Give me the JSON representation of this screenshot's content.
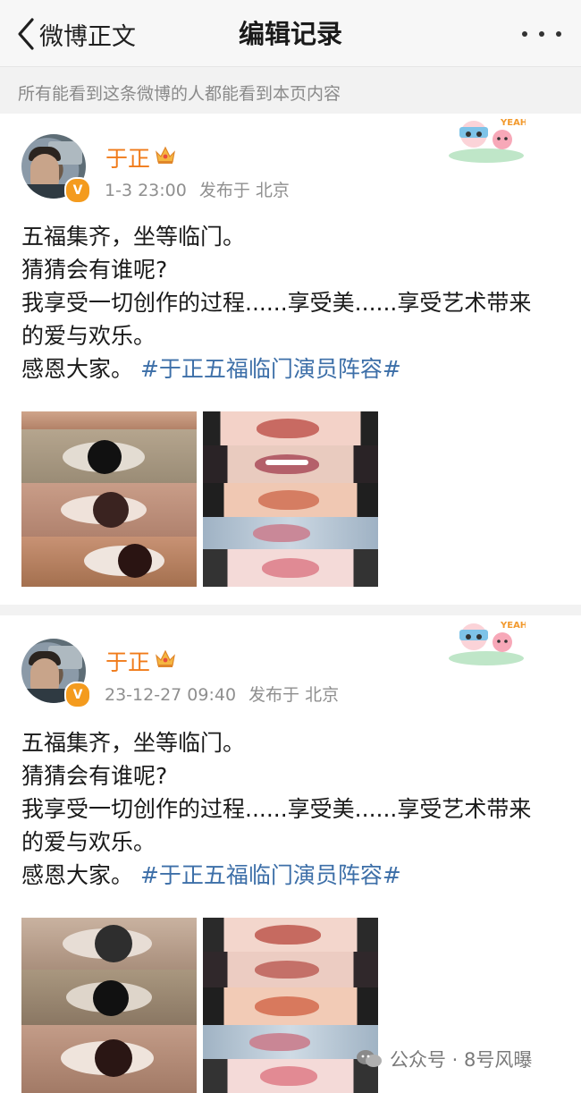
{
  "nav": {
    "back_label": "微博正文",
    "title": "编辑记录"
  },
  "notice": "所有能看到这条微博的人都能看到本页内容",
  "posts": [
    {
      "username": "于正",
      "time": "1-3 23:00",
      "published_at": "发布于 北京",
      "lines": [
        "五福集齐，坐等临门。",
        "猜猜会有谁呢?",
        "我享受一切创作的过程......享受美......享受艺术带来",
        "的爱与欢乐。"
      ],
      "last_line_prefix": "感恩大家。 ",
      "hashtag": "#于正五福临门演员阵容#",
      "images": [
        "eyes-collage",
        "lips-collage"
      ]
    },
    {
      "username": "于正",
      "time": "23-12-27 09:40",
      "published_at": "发布于 北京",
      "lines": [
        "五福集齐，坐等临门。",
        "猜猜会有谁呢?",
        "我享受一切创作的过程......享受美......享受艺术带来",
        "的爱与欢乐。"
      ],
      "last_line_prefix": "感恩大家。 ",
      "hashtag": "#于正五福临门演员阵容#",
      "images": [
        "eyes-collage",
        "lips-collage"
      ]
    }
  ],
  "verified_badge": "V",
  "sticker_text": "YEAH",
  "watermark": "公众号 · 8号风曝",
  "colors": {
    "username": "#f07b1a",
    "hashtag": "#3d6fa8",
    "meta": "#8f8f8f",
    "verified": "#f49b1e"
  },
  "icons": [
    "back-chevron-icon",
    "more-dots-icon",
    "verified-icon",
    "crown-icon",
    "sticker-icon",
    "wechat-icon"
  ]
}
